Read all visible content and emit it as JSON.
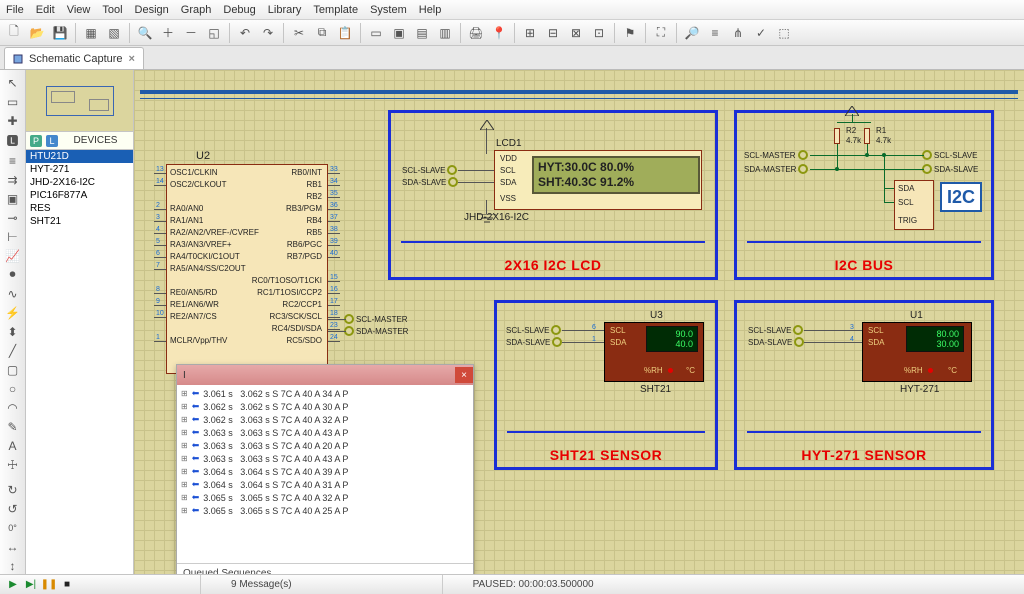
{
  "menus": [
    "File",
    "Edit",
    "View",
    "Tool",
    "Design",
    "Graph",
    "Debug",
    "Library",
    "Template",
    "System",
    "Help"
  ],
  "tab": {
    "label": "Schematic Capture"
  },
  "devices": {
    "header": "DEVICES",
    "items": [
      "HTU21D",
      "HYT-271",
      "JHD-2X16-I2C",
      "PIC16F877A",
      "RES",
      "SHT21"
    ]
  },
  "chip": {
    "ref": "U2",
    "left": [
      "OSC1/CLKIN",
      "OSC2/CLKOUT",
      "",
      "RA0/AN0",
      "RA1/AN1",
      "RA2/AN2/VREF-/CVREF",
      "RA3/AN3/VREF+",
      "RA4/T0CKI/C1OUT",
      "RA5/AN4/SS/C2OUT",
      "",
      "RE0/AN5/RD",
      "RE1/AN6/WR",
      "RE2/AN7/CS",
      "",
      "MCLR/Vpp/THV"
    ],
    "right": [
      "RB0/INT",
      "RB1",
      "RB2",
      "RB3/PGM",
      "RB4",
      "RB5",
      "RB6/PGC",
      "RB7/PGD",
      "",
      "RC0/T1OSO/T1CKI",
      "RC1/T1OSI/CCP2",
      "RC2/CCP1",
      "RC3/SCK/SCL",
      "RC4/SDI/SDA",
      "RC5/SDO"
    ],
    "leftnums": [
      "13",
      "14",
      "",
      "2",
      "3",
      "4",
      "5",
      "6",
      "7",
      "",
      "8",
      "9",
      "10",
      "",
      "1"
    ],
    "rightnums": [
      "33",
      "34",
      "35",
      "36",
      "37",
      "38",
      "39",
      "40",
      "",
      "15",
      "16",
      "17",
      "18",
      "23",
      "24"
    ]
  },
  "lcd": {
    "ref": "LCD1",
    "part": "JHD-2X16-I2C",
    "line1": "HYT:30.0C 80.0%",
    "line2": "SHT:40.3C 91.2%",
    "pins": [
      "VDD",
      "SCL",
      "SDA",
      "VSS"
    ]
  },
  "block_titles": {
    "lcd": "2X16 I2C LCD",
    "bus": "I2C BUS",
    "sht": "SHT21 SENSOR",
    "hyt": "HYT-271 SENSOR"
  },
  "bus": {
    "r1": "R1",
    "r2": "R2",
    "rval": "4.7k",
    "i2c": "I2C",
    "pins": [
      "SDA",
      "SCL",
      "TRIG"
    ]
  },
  "nets": {
    "scl_slave": "SCL-SLAVE",
    "sda_slave": "SDA-SLAVE",
    "scl_master": "SCL-MASTER",
    "sda_master": "SDA-MASTER"
  },
  "sht": {
    "ref": "U3",
    "part": "SHT21",
    "val1": "90.0",
    "val2": "40.0",
    "rh": "%RH",
    "c": "°C",
    "scl": "SCL",
    "sda": "SDA"
  },
  "hyt": {
    "ref": "U1",
    "part": "HYT-271",
    "val1": "80.00",
    "val2": "30.00",
    "rh": "%RH",
    "c": "°C",
    "scl": "SCL",
    "sda": "SDA"
  },
  "console": {
    "title": "I",
    "rows": [
      "3.061 s   3.062 s S 7C A 40 A 34 A P",
      "3.062 s   3.062 s S 7C A 40 A 30 A P",
      "3.062 s   3.063 s S 7C A 40 A 32 A P",
      "3.063 s   3.063 s S 7C A 40 A 43 A P",
      "3.063 s   3.063 s S 7C A 40 A 20 A P",
      "3.063 s   3.063 s S 7C A 40 A 43 A P",
      "3.064 s   3.064 s S 7C A 40 A 39 A P",
      "3.064 s   3.064 s S 7C A 40 A 31 A P",
      "3.065 s   3.065 s S 7C A 40 A 32 A P",
      "3.065 s   3.065 s S 7C A 40 A 25 A P"
    ],
    "footer": "Queued Sequences"
  },
  "status": {
    "messages": "9 Message(s)",
    "paused": "PAUSED: 00:00:03.500000"
  },
  "pinnums": {
    "sht_scl": "6",
    "sht_sda": "1",
    "hyt_scl": "3",
    "hyt_sda": "4"
  }
}
